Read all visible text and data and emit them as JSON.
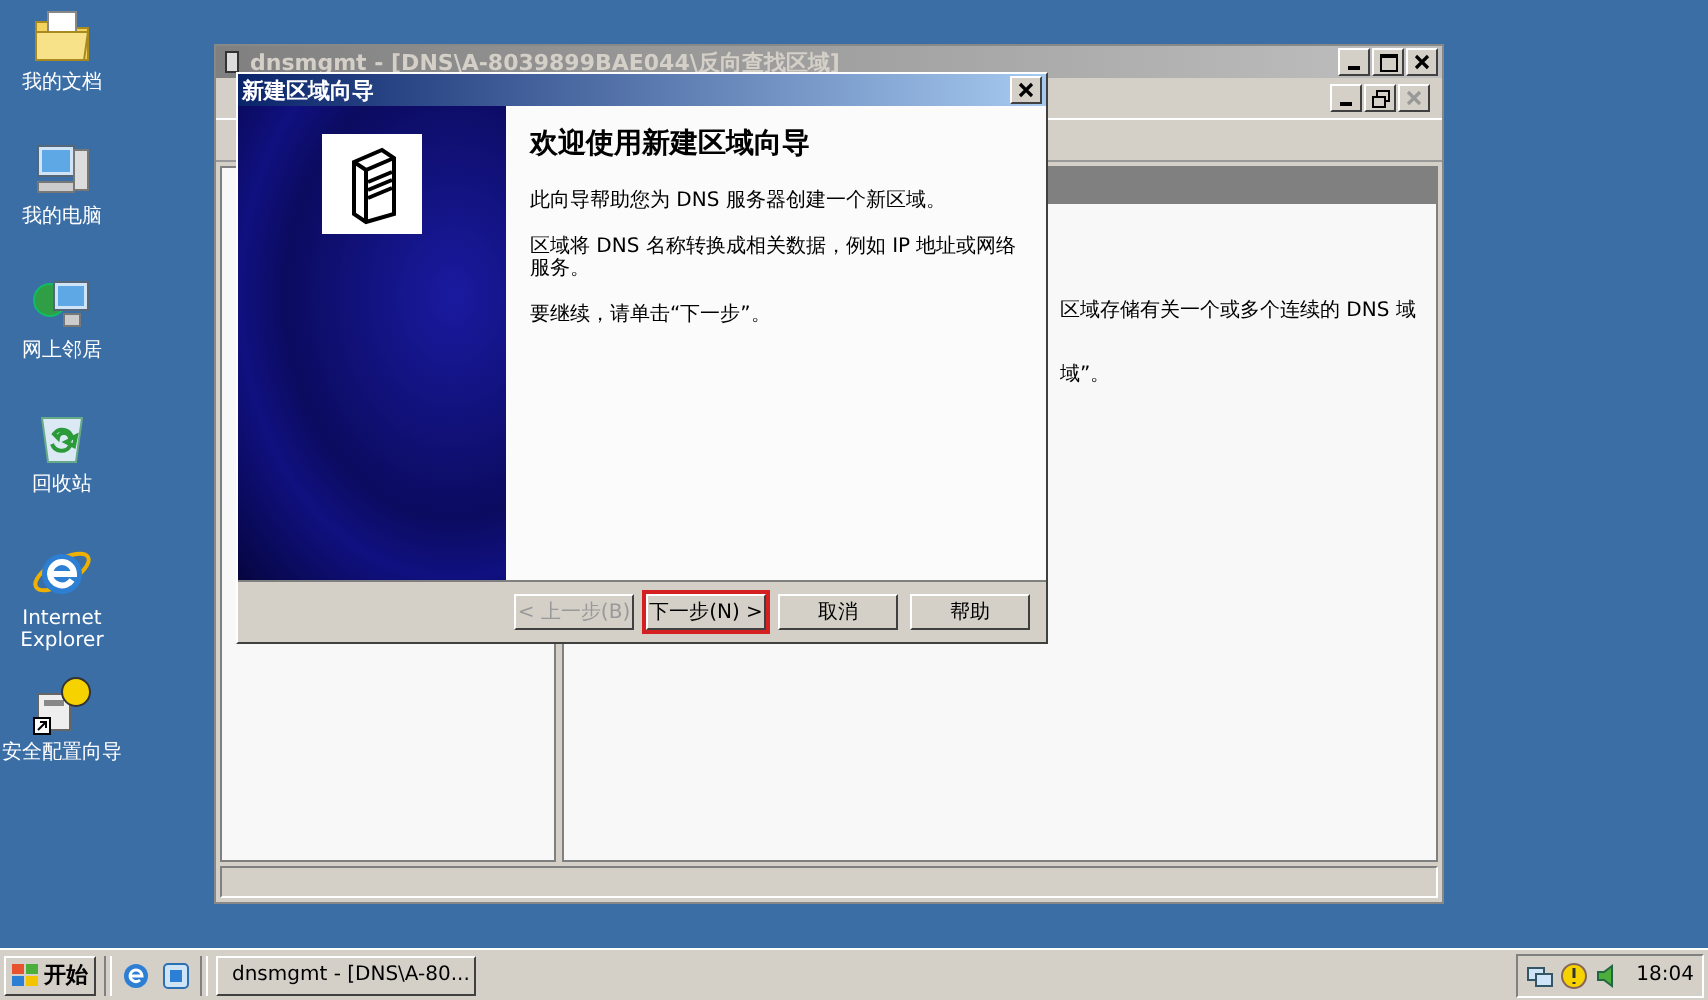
{
  "desktop_icons": [
    {
      "label": "我的文档",
      "kind": "documents"
    },
    {
      "label": "我的电脑",
      "kind": "computer"
    },
    {
      "label": "网上邻居",
      "kind": "network"
    },
    {
      "label": "回收站",
      "kind": "recycle"
    },
    {
      "label": "Internet Explorer",
      "kind": "ie"
    },
    {
      "label": "安全配置向导",
      "kind": "wizard"
    }
  ],
  "main_window": {
    "title": "dnsmgmt - [DNS\\A-8039899BAE044\\反向查找区域]",
    "right_pane_lines": [
      "区域存储有关一个或多个连续的 DNS 域",
      "域”。"
    ]
  },
  "dialog": {
    "title": "新建区域向导",
    "heading": "欢迎使用新建区域向导",
    "paragraphs": [
      "此向导帮助您为 DNS 服务器创建一个新区域。",
      "区域将 DNS 名称转换成相关数据，例如 IP 地址或网络服务。",
      "要继续，请单击“下一步”。"
    ],
    "buttons": [
      {
        "label": "< 上一步(B)",
        "disabled": true,
        "highlighted": false
      },
      {
        "label": "下一步(N) >",
        "disabled": false,
        "highlighted": true
      },
      {
        "label": "取消",
        "disabled": false,
        "highlighted": false
      },
      {
        "label": "帮助",
        "disabled": false,
        "highlighted": false
      }
    ]
  },
  "taskbar": {
    "start": "开始",
    "tasks": [
      {
        "label": "dnsmgmt - [DNS\\A-80...",
        "selected": false
      }
    ],
    "clock": "18:04"
  }
}
